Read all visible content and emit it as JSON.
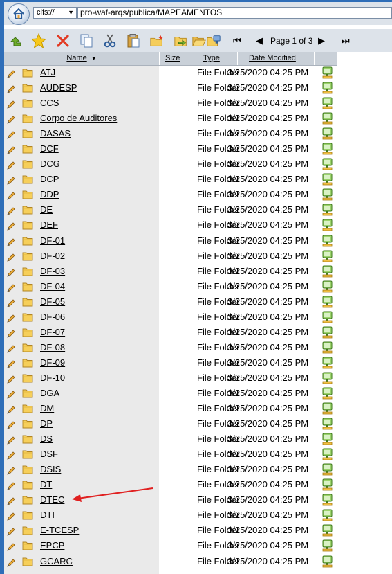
{
  "address_bar": {
    "protocol": "cifs://",
    "path": "pro-waf-arqs/publica/MAPEAMENTOS"
  },
  "toolbar": {
    "icons": [
      "up-folder-icon",
      "favorite-star-icon",
      "delete-icon",
      "copy-icon",
      "cut-icon",
      "paste-icon",
      "new-folder-icon",
      "move-icon",
      "open-folder-icon",
      "map-drive-icon"
    ],
    "page_label": "Page 1 of 3"
  },
  "columns": {
    "name": "Name",
    "size": "Size",
    "type": "Type",
    "date": "Date Modified"
  },
  "files": [
    {
      "name": "ATJ",
      "type": "File Folder",
      "date": "3/25/2020 04:25 PM"
    },
    {
      "name": "AUDESP",
      "type": "File Folder",
      "date": "3/25/2020 04:25 PM"
    },
    {
      "name": "CCS",
      "type": "File Folder",
      "date": "3/25/2020 04:25 PM"
    },
    {
      "name": "Corpo de Auditores",
      "type": "File Folder",
      "date": "3/25/2020 04:25 PM"
    },
    {
      "name": "DASAS",
      "type": "File Folder",
      "date": "3/25/2020 04:25 PM"
    },
    {
      "name": "DCF",
      "type": "File Folder",
      "date": "3/25/2020 04:25 PM"
    },
    {
      "name": "DCG",
      "type": "File Folder",
      "date": "3/25/2020 04:25 PM"
    },
    {
      "name": "DCP",
      "type": "File Folder",
      "date": "3/25/2020 04:25 PM"
    },
    {
      "name": "DDP",
      "type": "File Folder",
      "date": "3/25/2020 04:25 PM"
    },
    {
      "name": "DE",
      "type": "File Folder",
      "date": "3/25/2020 04:25 PM"
    },
    {
      "name": "DEF",
      "type": "File Folder",
      "date": "3/25/2020 04:25 PM"
    },
    {
      "name": "DF-01",
      "type": "File Folder",
      "date": "3/25/2020 04:25 PM"
    },
    {
      "name": "DF-02",
      "type": "File Folder",
      "date": "3/25/2020 04:25 PM"
    },
    {
      "name": "DF-03",
      "type": "File Folder",
      "date": "3/25/2020 04:25 PM"
    },
    {
      "name": "DF-04",
      "type": "File Folder",
      "date": "3/25/2020 04:25 PM"
    },
    {
      "name": "DF-05",
      "type": "File Folder",
      "date": "3/25/2020 04:25 PM"
    },
    {
      "name": "DF-06",
      "type": "File Folder",
      "date": "3/25/2020 04:25 PM"
    },
    {
      "name": "DF-07",
      "type": "File Folder",
      "date": "3/25/2020 04:25 PM"
    },
    {
      "name": "DF-08",
      "type": "File Folder",
      "date": "3/25/2020 04:25 PM"
    },
    {
      "name": "DF-09",
      "type": "File Folder",
      "date": "3/25/2020 04:25 PM"
    },
    {
      "name": "DF-10",
      "type": "File Folder",
      "date": "3/25/2020 04:25 PM"
    },
    {
      "name": "DGA",
      "type": "File Folder",
      "date": "3/25/2020 04:25 PM"
    },
    {
      "name": "DM",
      "type": "File Folder",
      "date": "3/25/2020 04:25 PM"
    },
    {
      "name": "DP",
      "type": "File Folder",
      "date": "3/25/2020 04:25 PM"
    },
    {
      "name": "DS",
      "type": "File Folder",
      "date": "3/25/2020 04:25 PM"
    },
    {
      "name": "DSF",
      "type": "File Folder",
      "date": "3/25/2020 04:25 PM"
    },
    {
      "name": "DSIS",
      "type": "File Folder",
      "date": "3/25/2020 04:25 PM"
    },
    {
      "name": "DT",
      "type": "File Folder",
      "date": "3/25/2020 04:25 PM"
    },
    {
      "name": "DTEC",
      "type": "File Folder",
      "date": "3/25/2020 04:25 PM"
    },
    {
      "name": "DTI",
      "type": "File Folder",
      "date": "3/25/2020 04:25 PM"
    },
    {
      "name": "E-TCESP",
      "type": "File Folder",
      "date": "3/25/2020 04:25 PM"
    },
    {
      "name": "EPCP",
      "type": "File Folder",
      "date": "3/25/2020 04:25 PM"
    },
    {
      "name": "GCARC",
      "type": "File Folder",
      "date": "3/25/2020 04:25 PM"
    }
  ],
  "annotation": {
    "target": "DTEC",
    "color": "#e02020"
  }
}
